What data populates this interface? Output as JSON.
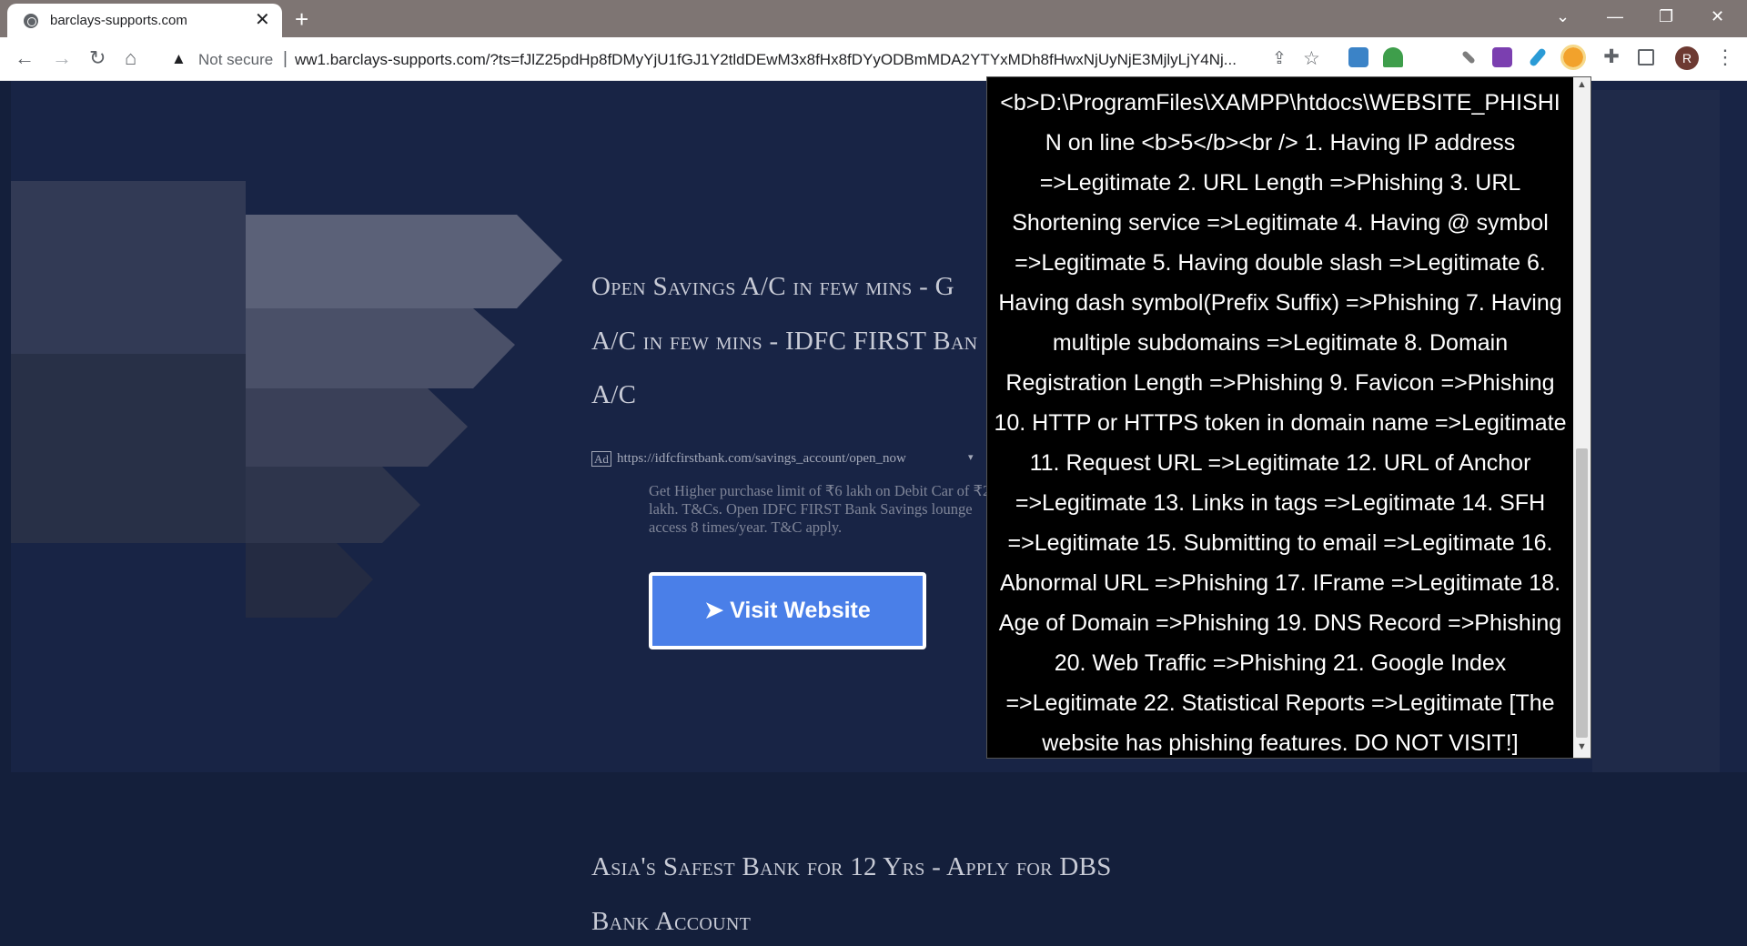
{
  "browser": {
    "tab_title": "barclays-supports.com",
    "tab_close": "✕",
    "new_tab": "+",
    "security_warning": "Not secure",
    "url": "ww1.barclays-supports.com/?ts=fJlZ25pdHp8fDMyYjU1fGJ1Y2tldDEwM3x8fHx8fDYyODBmMDA2YTYxMDh8fHwxNjUyNjE3MjlyLjY4Nj...",
    "avatar_letter": "R",
    "window_controls": {
      "dropdown": "⌄",
      "minimize": "—",
      "restore": "❐",
      "close": "✕"
    }
  },
  "ad1": {
    "title_line1": "Open Savings A/C in few mins - G",
    "title_line2": "A/C in few mins - IDFC FIRST Ban",
    "title_line3": "A/C",
    "badge": "Ad",
    "url": "https://idfcfirstbank.com/savings_account/open_now",
    "caret": "▾",
    "description": "Get Higher purchase limit of ₹6 lakh on Debit Car of ₹2 lakh. T&Cs. Open IDFC FIRST Bank Savings lounge access 8 times/year. T&C apply.",
    "button_label": "➤ Visit Website"
  },
  "ad2": {
    "title_line1": "Asia's Safest Bank for 12 Yrs - Apply for DBS",
    "title_line2": "Bank Account"
  },
  "popup": {
    "text": "<b>D:\\ProgramFiles\\XAMPP\\htdocs\\WEBSITE_PHISHIN on line <b>5</b><br /> 1. Having IP address =>Legitimate 2. URL Length =>Phishing 3. URL Shortening service =>Legitimate 4. Having @ symbol =>Legitimate 5. Having double slash =>Legitimate 6. Having dash symbol(Prefix Suffix) =>Phishing 7. Having multiple subdomains =>Legitimate 8. Domain Registration Length =>Phishing 9. Favicon =>Phishing 10. HTTP or HTTPS token in domain name =>Legitimate 11. Request URL =>Legitimate 12. URL of Anchor =>Legitimate 13. Links in tags =>Legitimate 14. SFH =>Legitimate 15. Submitting to email =>Legitimate 16. Abnormal URL =>Phishing 17. IFrame =>Legitimate 18. Age of Domain =>Phishing 19. DNS Record =>Phishing 20. Web Traffic =>Phishing 21. Google Index =>Legitimate 22. Statistical Reports =>Legitimate [The website has phishing features. DO NOT VISIT!]"
  },
  "colors": {
    "page_bg": "#141f3b",
    "chevron_light": "#5b6178",
    "chevron_mid": "#3a4058",
    "button_blue": "#4a7fe8",
    "titlebar": "#7e7573"
  }
}
